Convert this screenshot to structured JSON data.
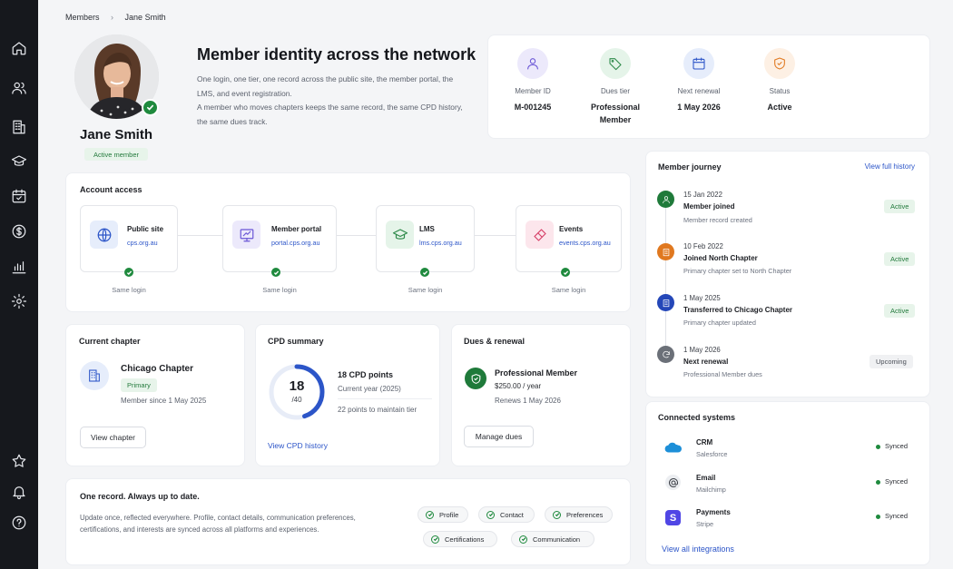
{
  "breadcrumb": {
    "root": "Members",
    "separator": "›",
    "current": "Jane Smith"
  },
  "profile": {
    "name": "Jane Smith",
    "status": "Active member"
  },
  "hero": {
    "title": "Member identity across the network",
    "para1": "One login, one tier, one record across the public site, the member portal, the LMS, and event registration.",
    "para2": "A member who moves chapters keeps the same record, the same CPD history, the same dues track."
  },
  "stats": [
    {
      "icon": "user-icon",
      "label": "Member ID",
      "value": "M-001245"
    },
    {
      "icon": "tag-icon",
      "label": "Dues tier",
      "value": "Professional Member"
    },
    {
      "icon": "calendar-icon",
      "label": "Next renewal",
      "value": "1 May 2026"
    },
    {
      "icon": "shield-icon",
      "label": "Status",
      "value": "Active"
    }
  ],
  "account_access": {
    "title": "Account access",
    "systems": [
      {
        "icon": "globe-icon",
        "name": "Public site",
        "url": "cps.org.au",
        "note": "Same login"
      },
      {
        "icon": "monitor-icon",
        "name": "Member portal",
        "url": "portal.cps.org.au",
        "note": "Same login"
      },
      {
        "icon": "graduation-cap-icon",
        "name": "LMS",
        "url": "lms.cps.org.au",
        "note": "Same login"
      },
      {
        "icon": "ticket-icon",
        "name": "Events",
        "url": "events.cps.org.au",
        "note": "Same login"
      }
    ]
  },
  "chapter": {
    "title": "Current chapter",
    "name": "Chicago Chapter",
    "badge": "Primary",
    "since": "Member since 1 May 2025",
    "button": "View chapter"
  },
  "cpd": {
    "title": "CPD summary",
    "current": "18",
    "total": "/40",
    "progress": 0.45,
    "points": "18 CPD points",
    "period": "Current year (2025)",
    "remaining": "22 points to maintain tier",
    "link": "View CPD history"
  },
  "dues": {
    "title": "Dues & renewal",
    "tier": "Professional Member",
    "price": "$250.00 / year",
    "renews": "Renews 1 May 2026",
    "button": "Manage dues"
  },
  "record": {
    "title": "One record. Always up to date.",
    "text": "Update once, reflected everywhere. Profile, contact details, communication preferences, certifications, and interests are synced across all platforms and experiences.",
    "chips": [
      "Profile",
      "Contact",
      "Preferences",
      "Certifications",
      "Communication"
    ]
  },
  "journey": {
    "title": "Member journey",
    "link": "View full history",
    "events": [
      {
        "date": "15 Jan 2022",
        "title": "Member joined",
        "desc": "Member record created",
        "badge": "Active",
        "icon": "user-icon",
        "color": "#1f7a3a"
      },
      {
        "date": "10 Feb 2022",
        "title": "Joined North Chapter",
        "desc": "Primary chapter set to North Chapter",
        "badge": "Active",
        "icon": "building-icon",
        "color": "#e0781f"
      },
      {
        "date": "1 May 2025",
        "title": "Transferred to Chicago Chapter",
        "desc": "Primary chapter updated",
        "badge": "Active",
        "icon": "building-icon",
        "color": "#2447b8"
      },
      {
        "date": "1 May 2026",
        "title": "Next renewal",
        "desc": "Professional Member dues",
        "badge": "Upcoming",
        "icon": "refresh-icon",
        "color": "#6b7078"
      }
    ]
  },
  "connected": {
    "title": "Connected systems",
    "link": "View all integrations",
    "systems": [
      {
        "name": "CRM",
        "vendor": "Salesforce",
        "status": "Synced",
        "icon": "cloud-icon"
      },
      {
        "name": "Email",
        "vendor": "Mailchimp",
        "status": "Synced",
        "icon": "at-icon"
      },
      {
        "name": "Payments",
        "vendor": "Stripe",
        "status": "Synced",
        "icon": "stripe-icon"
      }
    ]
  },
  "colors": {
    "accent": "#2c55c8",
    "success": "#1f8a3e",
    "sidebar": "#16181d"
  }
}
